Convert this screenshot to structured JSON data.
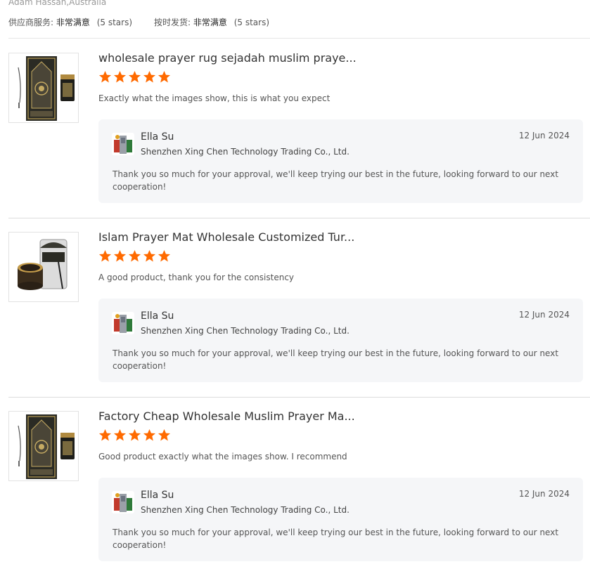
{
  "reviewer": "Adam Hassan,Australia",
  "ratings": [
    {
      "label": "供应商服务:",
      "value": "非常满意",
      "stars": "(5 stars)"
    },
    {
      "label": "按时发货:",
      "value": "非常满意",
      "stars": "(5 stars)"
    }
  ],
  "reviews": [
    {
      "product_title": "wholesale prayer rug sejadah muslim praye...",
      "rating": 5,
      "comment": "Exactly what the images show, this is what you expect",
      "reply": {
        "seller_name": "Ella Su",
        "company": "Shenzhen Xing Chen Technology Trading Co., Ltd.",
        "date": "12 Jun 2024",
        "text": "Thank you so much for your approval, we'll keep trying our best in the future, looking forward to our next cooperation!"
      }
    },
    {
      "product_title": "Islam Prayer Mat Wholesale Customized Tur...",
      "rating": 5,
      "comment": "A good product, thank you for the consistency",
      "reply": {
        "seller_name": "Ella Su",
        "company": "Shenzhen Xing Chen Technology Trading Co., Ltd.",
        "date": "12 Jun 2024",
        "text": "Thank you so much for your approval, we'll keep trying our best in the future, looking forward to our next cooperation!"
      }
    },
    {
      "product_title": "Factory Cheap Wholesale Muslim Prayer Ma...",
      "rating": 5,
      "comment": "Good product exactly what the images show. I recommend",
      "reply": {
        "seller_name": "Ella Su",
        "company": "Shenzhen Xing Chen Technology Trading Co., Ltd.",
        "date": "12 Jun 2024",
        "text": "Thank you so much for your approval, we'll keep trying our best in the future, looking forward to our next cooperation!"
      }
    }
  ],
  "colors": {
    "star": "#ff6a00",
    "reply_bg": "#f5f6f8"
  }
}
